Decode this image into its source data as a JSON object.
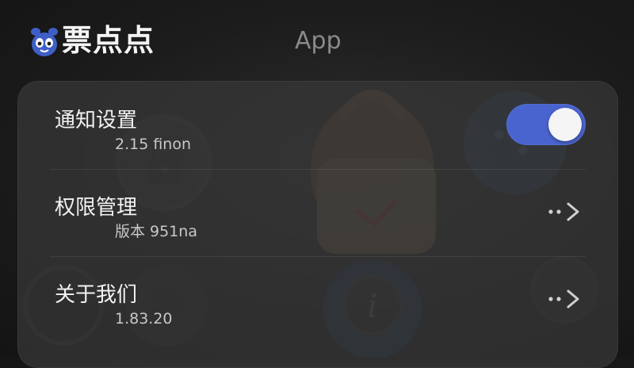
{
  "header": {
    "brand": "票点点",
    "title": "App",
    "logo_icon": "mascot-logo-icon"
  },
  "settings": [
    {
      "label": "通知设置",
      "subtitle": "2.15 finon",
      "control": "toggle",
      "toggle_on": true
    },
    {
      "label": "权限管理",
      "subtitle": "版本 951na",
      "control": "chevron"
    },
    {
      "label": "关于我们",
      "subtitle": "1.83.20",
      "control": "chevron"
    }
  ],
  "colors": {
    "accent": "#4a64cf",
    "background": "#1c1c1c",
    "card": "#383838"
  },
  "background_icons": [
    "lock-icon",
    "lock-icon",
    "chat-icon",
    "bag-icon",
    "info-icon",
    "gear-icon"
  ]
}
